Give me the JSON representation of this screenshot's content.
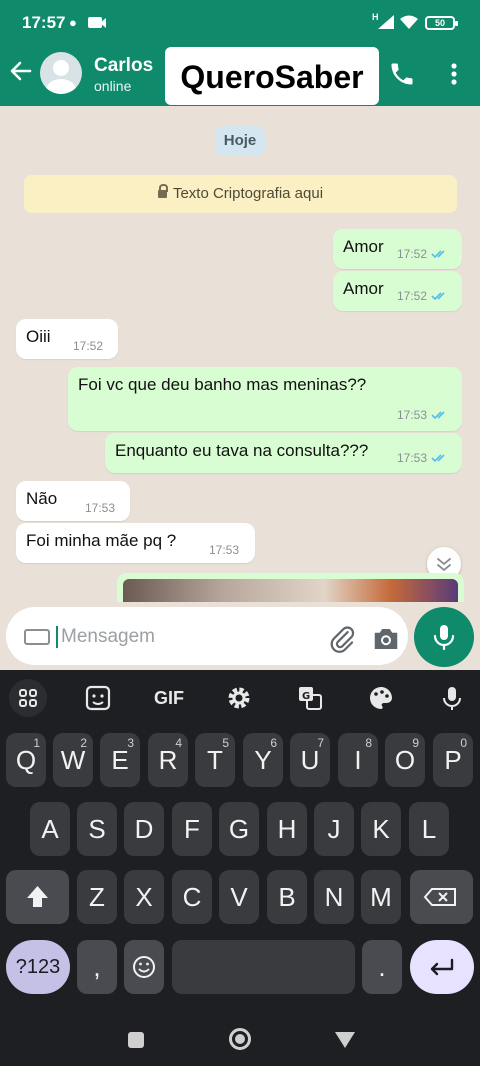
{
  "status_bar": {
    "time": "17:57",
    "signal": "H",
    "battery": "50"
  },
  "header": {
    "contact_name": "Carlos",
    "contact_status": "online",
    "overlay_text": "QueroSaber"
  },
  "chat": {
    "date_label": "Hoje",
    "encryption_notice": "Texto Criptografia aqui",
    "messages": [
      {
        "dir": "out",
        "text": "Amor",
        "time": "17:52"
      },
      {
        "dir": "out",
        "text": "Amor",
        "time": "17:52"
      },
      {
        "dir": "in",
        "text": "Oiii",
        "time": "17:52"
      },
      {
        "dir": "out",
        "text": "Foi vc que deu banho mas meninas??",
        "time": "17:53"
      },
      {
        "dir": "out",
        "text": "Enquanto eu tava na consulta???",
        "time": "17:53"
      },
      {
        "dir": "in",
        "text": "Não",
        "time": "17:53"
      },
      {
        "dir": "in",
        "text": "Foi minha mãe pq ?",
        "time": "17:53"
      }
    ]
  },
  "composer": {
    "placeholder": "Mensagem"
  },
  "keyboard": {
    "tools": [
      "apps-grid",
      "sticker",
      "GIF",
      "settings",
      "translate",
      "palette",
      "voice"
    ],
    "row1": [
      {
        "key": "Q",
        "hint": "1"
      },
      {
        "key": "W",
        "hint": "2"
      },
      {
        "key": "E",
        "hint": "3"
      },
      {
        "key": "R",
        "hint": "4"
      },
      {
        "key": "T",
        "hint": "5"
      },
      {
        "key": "Y",
        "hint": "6"
      },
      {
        "key": "U",
        "hint": "7"
      },
      {
        "key": "I",
        "hint": "8"
      },
      {
        "key": "O",
        "hint": "9"
      },
      {
        "key": "P",
        "hint": "0"
      }
    ],
    "row2": [
      "A",
      "S",
      "D",
      "F",
      "G",
      "H",
      "J",
      "K",
      "L"
    ],
    "row3": [
      "Z",
      "X",
      "C",
      "V",
      "B",
      "N",
      "M"
    ],
    "symbols_key": "?123",
    "comma_key": ",",
    "period_key": "."
  },
  "colors": {
    "header": "#0f8a6b",
    "outgoing": "#d9fdd3",
    "incoming": "#ffffff",
    "ticks": "#53bdeb"
  }
}
